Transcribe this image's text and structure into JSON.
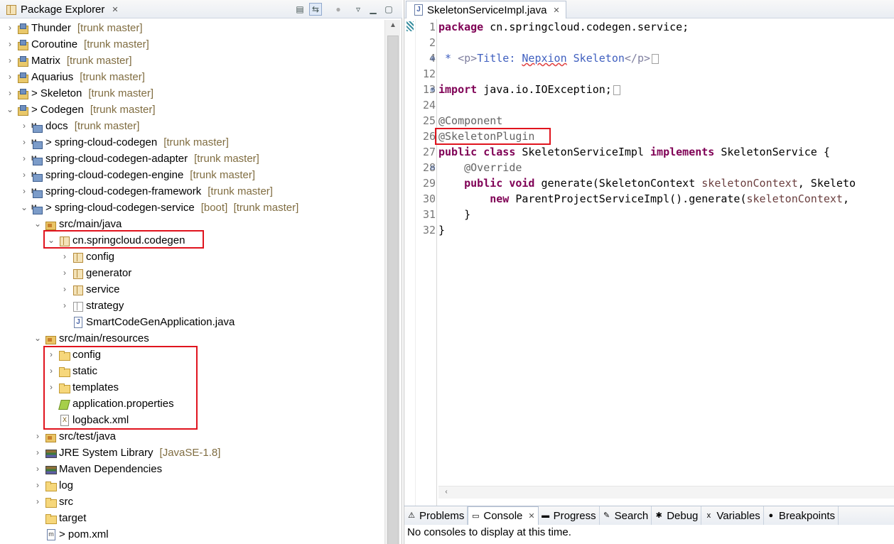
{
  "package_explorer": {
    "title": "Package Explorer",
    "tree": [
      {
        "label": "Thunder",
        "decoration": "[trunk master]",
        "icon": "project-icon",
        "expanded": false
      },
      {
        "label": "Coroutine",
        "decoration": "[trunk master]",
        "icon": "project-icon",
        "expanded": false
      },
      {
        "label": "Matrix",
        "decoration": "[trunk master]",
        "icon": "project-icon",
        "expanded": false
      },
      {
        "label": "Aquarius",
        "decoration": "[trunk master]",
        "icon": "project-icon",
        "expanded": false
      },
      {
        "label": "> Skeleton",
        "decoration": "[trunk master]",
        "icon": "project-icon",
        "expanded": false
      },
      {
        "label": "> Codegen",
        "decoration": "[trunk master]",
        "icon": "project-icon",
        "expanded": true
      },
      {
        "label": "docs",
        "decoration": "[trunk master]",
        "icon": "maven-module-icon",
        "expanded": false
      },
      {
        "label": "> spring-cloud-codegen",
        "decoration": "[trunk master]",
        "icon": "maven-module-icon",
        "expanded": false
      },
      {
        "label": "spring-cloud-codegen-adapter",
        "decoration": "[trunk master]",
        "icon": "maven-module-icon",
        "expanded": false
      },
      {
        "label": "spring-cloud-codegen-engine",
        "decoration": "[trunk master]",
        "icon": "maven-module-icon",
        "expanded": false
      },
      {
        "label": "spring-cloud-codegen-framework",
        "decoration": "[trunk master]",
        "icon": "maven-module-icon",
        "expanded": false
      },
      {
        "label": "> spring-cloud-codegen-service",
        "decoration": "[boot]  [trunk master]",
        "icon": "maven-module-icon",
        "expanded": true
      },
      {
        "label": "src/main/java",
        "decoration": "",
        "icon": "source-folder-icon",
        "expanded": true
      },
      {
        "label": "cn.springcloud.codegen",
        "decoration": "",
        "icon": "package-icon",
        "expanded": true
      },
      {
        "label": "config",
        "decoration": "",
        "icon": "package-icon",
        "expanded": false
      },
      {
        "label": "generator",
        "decoration": "",
        "icon": "package-icon",
        "expanded": false
      },
      {
        "label": "service",
        "decoration": "",
        "icon": "package-icon",
        "expanded": false
      },
      {
        "label": "strategy",
        "decoration": "",
        "icon": "empty-package-icon",
        "expanded": false
      },
      {
        "label": "SmartCodeGenApplication.java",
        "decoration": "",
        "icon": "java-file-icon",
        "expanded": false
      },
      {
        "label": "src/main/resources",
        "decoration": "",
        "icon": "source-folder-icon",
        "expanded": true
      },
      {
        "label": "config",
        "decoration": "",
        "icon": "folder-icon",
        "expanded": false
      },
      {
        "label": "static",
        "decoration": "",
        "icon": "folder-icon",
        "expanded": false
      },
      {
        "label": "templates",
        "decoration": "",
        "icon": "folder-icon",
        "expanded": false
      },
      {
        "label": "application.properties",
        "decoration": "",
        "icon": "properties-file-icon",
        "expanded": false
      },
      {
        "label": "logback.xml",
        "decoration": "",
        "icon": "xml-file-icon",
        "expanded": false
      },
      {
        "label": "src/test/java",
        "decoration": "",
        "icon": "source-folder-icon",
        "expanded": false
      },
      {
        "label": "JRE System Library",
        "decoration": "[JavaSE-1.8]",
        "icon": "library-icon",
        "expanded": false
      },
      {
        "label": "Maven Dependencies",
        "decoration": "",
        "icon": "library-icon",
        "expanded": false
      },
      {
        "label": "log",
        "decoration": "",
        "icon": "folder-icon",
        "expanded": false
      },
      {
        "label": "src",
        "decoration": "",
        "icon": "folder-icon",
        "expanded": false
      },
      {
        "label": "target",
        "decoration": "",
        "icon": "folder-icon",
        "expanded": false
      },
      {
        "label": "> pom.xml",
        "decoration": "",
        "icon": "pom-file-icon",
        "expanded": false
      }
    ]
  },
  "editor": {
    "tab_title": "SkeletonServiceImpl.java",
    "lines": [
      {
        "num": "1",
        "fold": ""
      },
      {
        "num": "2",
        "fold": ""
      },
      {
        "num": "4",
        "fold": "⊕"
      },
      {
        "num": "12",
        "fold": ""
      },
      {
        "num": "13",
        "fold": "⊕"
      },
      {
        "num": "24",
        "fold": ""
      },
      {
        "num": "25",
        "fold": ""
      },
      {
        "num": "26",
        "fold": ""
      },
      {
        "num": "27",
        "fold": ""
      },
      {
        "num": "28",
        "fold": "⊖"
      },
      {
        "num": "29",
        "fold": ""
      },
      {
        "num": "30",
        "fold": ""
      },
      {
        "num": "31",
        "fold": ""
      },
      {
        "num": "32",
        "fold": ""
      }
    ],
    "code": {
      "l1_kw": "package",
      "l1_rest": " cn.springcloud.codegen.service;",
      "l4_star": " * ",
      "l4_tag_open": "<p>",
      "l4_title": "Title: ",
      "l4_word": "Nepxion",
      "l4_rest": " Skeleton",
      "l4_tag_close": "</p>",
      "l13_kw": "import",
      "l13_rest": " java.io.IOException;",
      "l25": "@Component",
      "l26": "@SkeletonPlugin",
      "l27_kw1": "public class",
      "l27_mid": " SkeletonServiceImpl ",
      "l27_kw2": "implements",
      "l27_rest": " SkeletonService {",
      "l28": "    @Override",
      "l29_indent": "    ",
      "l29_kw": "public void",
      "l29_mid": " generate(SkeletonContext ",
      "l29_param": "skeletonContext",
      "l29_rest": ", Skeleto",
      "l30_indent": "        ",
      "l30_kw": "new",
      "l30_mid": " ParentProjectServiceImpl().generate(",
      "l30_param": "skeletonContext",
      "l30_rest": ",",
      "l31": "    }",
      "l32": "}"
    }
  },
  "bottom_panel": {
    "tabs": [
      {
        "label": "Problems",
        "icon": "problems-icon",
        "active": false,
        "closable": false
      },
      {
        "label": "Console",
        "icon": "console-icon",
        "active": true,
        "closable": true
      },
      {
        "label": "Progress",
        "icon": "progress-icon",
        "active": false,
        "closable": false
      },
      {
        "label": "Search",
        "icon": "search-icon",
        "active": false,
        "closable": false
      },
      {
        "label": "Debug",
        "icon": "debug-icon",
        "active": false,
        "closable": false
      },
      {
        "label": "Variables",
        "icon": "variables-icon",
        "active": false,
        "closable": false
      },
      {
        "label": "Breakpoints",
        "icon": "breakpoints-icon",
        "active": false,
        "closable": false
      }
    ],
    "message": "No consoles to display at this time."
  },
  "colors": {
    "highlight_box": "#e0141e",
    "decoration_text": "#806d41",
    "keyword": "#7f0055",
    "annotation": "#646464",
    "javadoc": "#3f5fbf"
  }
}
